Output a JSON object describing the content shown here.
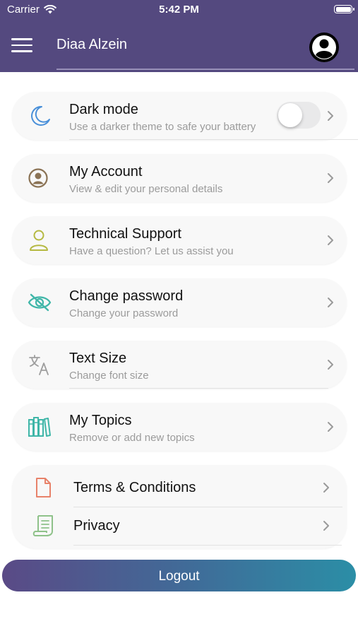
{
  "status_bar": {
    "carrier": "Carrier",
    "time": "5:42 PM"
  },
  "header": {
    "user_name": "Diaa Alzein"
  },
  "settings": [
    {
      "title": "Dark mode",
      "subtitle": "Use a darker theme to safe your battery",
      "icon": "moon-icon",
      "color": "#4a90d9",
      "toggle_on": false
    },
    {
      "title": "My Account",
      "subtitle": "View & edit your personal details",
      "icon": "account-icon",
      "color": "#8b7355"
    },
    {
      "title": "Technical Support",
      "subtitle": "Have a question? Let us assist you",
      "icon": "person-icon",
      "color": "#b5b942"
    },
    {
      "title": "Change password",
      "subtitle": "Change your password",
      "icon": "eye-off-icon",
      "color": "#3fb6a8"
    },
    {
      "title": "Text Size",
      "subtitle": "Change font size",
      "icon": "translate-icon",
      "color": "#9e9e9e"
    },
    {
      "title": "My Topics",
      "subtitle": "Remove or add new topics",
      "icon": "books-icon",
      "color": "#3fb6a8"
    }
  ],
  "legal": [
    {
      "title": "Terms & Conditions",
      "icon": "document-icon",
      "color": "#e8826a"
    },
    {
      "title": "Privacy",
      "icon": "scroll-icon",
      "color": "#8fc28a"
    }
  ],
  "logout_label": "Logout",
  "colors": {
    "header_bg": "#54497f",
    "logout_start": "#5a4a86",
    "logout_end": "#2b8ea6"
  }
}
